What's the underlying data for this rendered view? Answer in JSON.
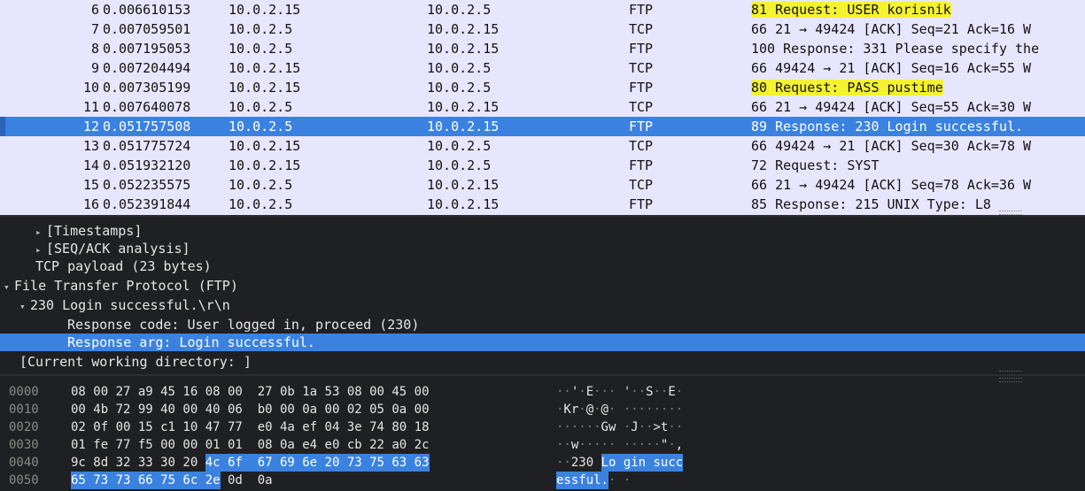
{
  "packets": [
    {
      "num": "6",
      "time": "0.006610153",
      "src": "10.0.2.15",
      "dst": "10.0.2.5",
      "proto": "FTP",
      "info_len": "81",
      "info_rest": " Request: USER korisnik",
      "highlight": true
    },
    {
      "num": "7",
      "time": "0.007059501",
      "src": "10.0.2.5",
      "dst": "10.0.2.15",
      "proto": "TCP",
      "info_len": "66",
      "info_rest": " 21 → 49424 [ACK] Seq=21 Ack=16 W",
      "highlight": false
    },
    {
      "num": "8",
      "time": "0.007195053",
      "src": "10.0.2.5",
      "dst": "10.0.2.15",
      "proto": "FTP",
      "info_len": "100",
      "info_rest": " Response: 331 Please specify the",
      "highlight": false
    },
    {
      "num": "9",
      "time": "0.007204494",
      "src": "10.0.2.15",
      "dst": "10.0.2.5",
      "proto": "TCP",
      "info_len": "66",
      "info_rest": " 49424 → 21 [ACK] Seq=16 Ack=55 W",
      "highlight": false
    },
    {
      "num": "10",
      "time": "0.007305199",
      "src": "10.0.2.15",
      "dst": "10.0.2.5",
      "proto": "FTP",
      "info_len": "80",
      "info_rest": " Request: PASS pustime",
      "highlight": true
    },
    {
      "num": "11",
      "time": "0.007640078",
      "src": "10.0.2.5",
      "dst": "10.0.2.15",
      "proto": "TCP",
      "info_len": "66",
      "info_rest": " 21 → 49424 [ACK] Seq=55 Ack=30 W",
      "highlight": false
    },
    {
      "num": "12",
      "time": "0.051757508",
      "src": "10.0.2.5",
      "dst": "10.0.2.15",
      "proto": "FTP",
      "info_len": "89",
      "info_rest": " Response: 230 Login successful.",
      "highlight": false,
      "selected": true
    },
    {
      "num": "13",
      "time": "0.051775724",
      "src": "10.0.2.15",
      "dst": "10.0.2.5",
      "proto": "TCP",
      "info_len": "66",
      "info_rest": " 49424 → 21 [ACK] Seq=30 Ack=78 W",
      "highlight": false
    },
    {
      "num": "14",
      "time": "0.051932120",
      "src": "10.0.2.15",
      "dst": "10.0.2.5",
      "proto": "FTP",
      "info_len": "72",
      "info_rest": " Request: SYST",
      "highlight": false
    },
    {
      "num": "15",
      "time": "0.052235575",
      "src": "10.0.2.5",
      "dst": "10.0.2.15",
      "proto": "TCP",
      "info_len": "66",
      "info_rest": " 21 → 49424 [ACK] Seq=78 Ack=36 W",
      "highlight": false
    },
    {
      "num": "16",
      "time": "0.052391844",
      "src": "10.0.2.5",
      "dst": "10.0.2.15",
      "proto": "FTP",
      "info_len": "85",
      "info_rest": " Response: 215 UNIX Type: L8",
      "highlight": false
    }
  ],
  "details": [
    {
      "indent": 4,
      "arrow": "collapsed",
      "text": "[Timestamps]"
    },
    {
      "indent": 4,
      "arrow": "collapsed",
      "text": "[SEQ/ACK analysis]"
    },
    {
      "indent": 4,
      "arrow": "none",
      "text": "TCP payload (23 bytes)"
    },
    {
      "indent": 0,
      "arrow": "expanded",
      "text": "File Transfer Protocol (FTP)"
    },
    {
      "indent": 2,
      "arrow": "expanded",
      "text": "230 Login successful.\\r\\n"
    },
    {
      "indent": 8,
      "arrow": "none",
      "text": "Response code: User logged in, proceed (230)"
    },
    {
      "indent": 8,
      "arrow": "none",
      "text": "Response arg: Login successful.",
      "selected": true
    },
    {
      "indent": 2,
      "arrow": "none",
      "text": "[Current working directory: ]"
    }
  ],
  "hex_rows": [
    {
      "offset": "0000",
      "bytes": [
        "08",
        "00",
        "27",
        "a9",
        "45",
        "16",
        "08",
        "00",
        "27",
        "0b",
        "1a",
        "53",
        "08",
        "00",
        "45",
        "00"
      ],
      "ascii": [
        "·",
        "·",
        "'",
        "·",
        "E",
        "·",
        "·",
        "·",
        "'",
        "·",
        "·",
        "S",
        "·",
        "·",
        "E",
        "·"
      ],
      "sel_from": 16
    },
    {
      "offset": "0010",
      "bytes": [
        "00",
        "4b",
        "72",
        "99",
        "40",
        "00",
        "40",
        "06",
        "b0",
        "00",
        "0a",
        "00",
        "02",
        "05",
        "0a",
        "00"
      ],
      "ascii": [
        "·",
        "K",
        "r",
        "·",
        "@",
        "·",
        "@",
        "·",
        "·",
        "·",
        "·",
        "·",
        "·",
        "·",
        "·",
        "·"
      ],
      "sel_from": 16
    },
    {
      "offset": "0020",
      "bytes": [
        "02",
        "0f",
        "00",
        "15",
        "c1",
        "10",
        "47",
        "77",
        "e0",
        "4a",
        "ef",
        "04",
        "3e",
        "74",
        "80",
        "18"
      ],
      "ascii": [
        "·",
        "·",
        "·",
        "·",
        "·",
        "·",
        "G",
        "w",
        "·",
        "J",
        "·",
        "·",
        ">",
        "t",
        "·",
        "·"
      ],
      "sel_from": 16
    },
    {
      "offset": "0030",
      "bytes": [
        "01",
        "fe",
        "77",
        "f5",
        "00",
        "00",
        "01",
        "01",
        "08",
        "0a",
        "e4",
        "e0",
        "cb",
        "22",
        "a0",
        "2c"
      ],
      "ascii": [
        "·",
        "·",
        "w",
        "·",
        "·",
        "·",
        "·",
        "·",
        "·",
        "·",
        "·",
        "·",
        "·",
        "\"",
        "·",
        ","
      ],
      "sel_from": 16
    },
    {
      "offset": "0040",
      "bytes": [
        "9c",
        "8d",
        "32",
        "33",
        "30",
        "20",
        "4c",
        "6f",
        "67",
        "69",
        "6e",
        "20",
        "73",
        "75",
        "63",
        "63"
      ],
      "ascii": [
        "·",
        "·",
        "2",
        "3",
        "0",
        " ",
        "L",
        "o",
        "g",
        "i",
        "n",
        " ",
        "s",
        "u",
        "c",
        "c"
      ],
      "sel_from": 6
    },
    {
      "offset": "0050",
      "bytes": [
        "65",
        "73",
        "73",
        "66",
        "75",
        "6c",
        "2e",
        "0d",
        "0a"
      ],
      "ascii": [
        "e",
        "s",
        "s",
        "f",
        "u",
        "l",
        ".",
        "·",
        "·"
      ],
      "sel_from": 0,
      "sel_to": 7
    }
  ],
  "colors": {
    "selection": "#3b82e0",
    "highlight": "#f5f231",
    "list_bg": "#e7e6ff",
    "pane_bg": "#1f2023"
  }
}
